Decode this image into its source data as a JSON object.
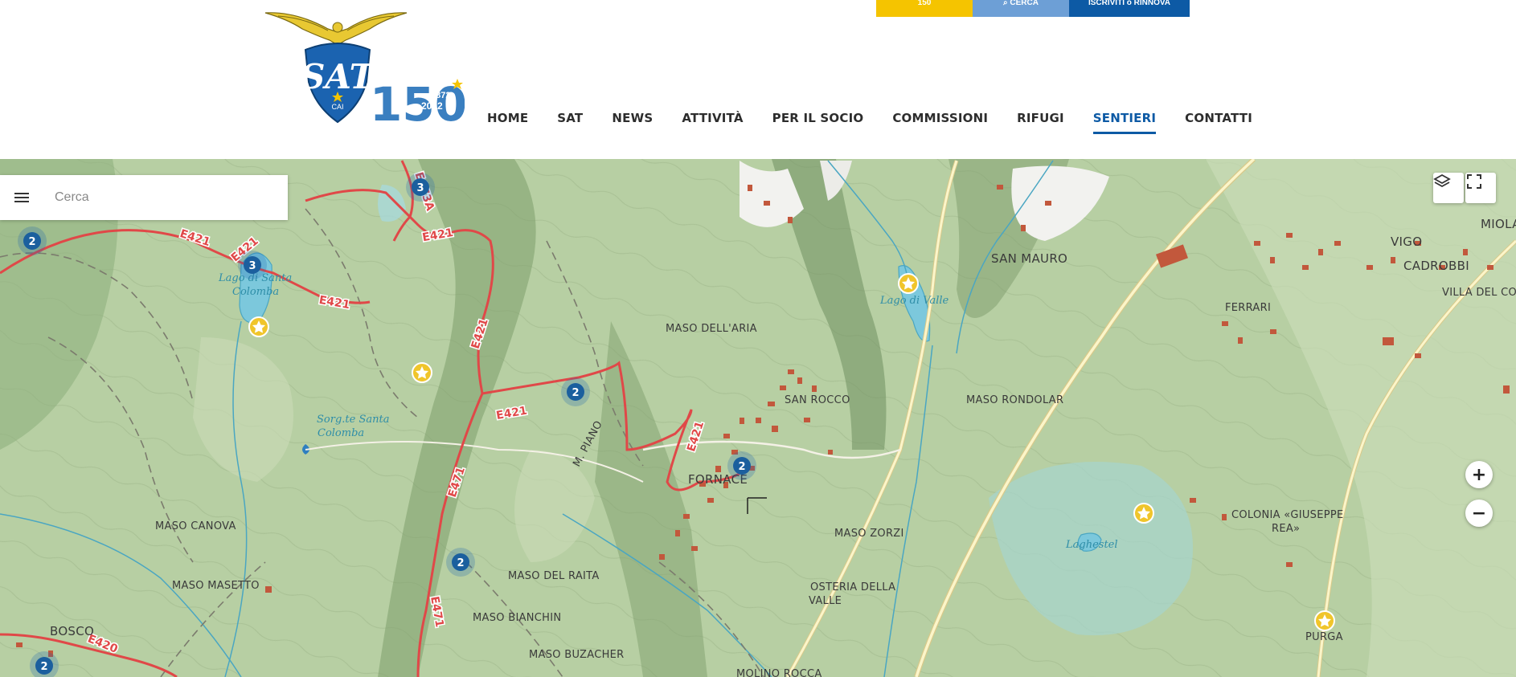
{
  "topbar": {
    "item_150": "150",
    "search": "CERCA",
    "join": "ISCRIVITI o RINNOVA"
  },
  "logo": {
    "sat_text": "SAT",
    "cai_text": "CAI",
    "anniversary": "150",
    "year_start": "1872",
    "year_end": "2022"
  },
  "nav": [
    {
      "label": "HOME"
    },
    {
      "label": "SAT"
    },
    {
      "label": "NEWS"
    },
    {
      "label": "ATTIVITÀ"
    },
    {
      "label": "PER IL SOCIO"
    },
    {
      "label": "COMMISSIONI"
    },
    {
      "label": "RIFUGI"
    },
    {
      "label": "SENTIERI",
      "active": true
    },
    {
      "label": "CONTATTI"
    }
  ],
  "search": {
    "placeholder": "Cerca",
    "menu_icon": "hamburger-menu-icon"
  },
  "map": {
    "places": {
      "san_mauro": "SAN MAURO",
      "vigo": "VIGO",
      "miola": "MIOLA",
      "cadrobbi": "CADROBBI",
      "villa": "VILLA DEL CO",
      "ferrari": "FERRARI",
      "maso_aria": "MASO DELL'ARIA",
      "san_rocco": "SAN ROCCO",
      "maso_rondolar": "MASO RONDOLAR",
      "fornace": "FORNACE",
      "maso_zorzi": "MASO ZORZI",
      "maso_canova": "MASO CANOVA",
      "maso_masetto": "MASO MASETTO",
      "maso_raita": "MASO DEL RAITA",
      "osteria_1": "OSTERIA DELLA",
      "osteria_2": "VALLE",
      "maso_bianchin": "MASO BIANCHIN",
      "maso_buzacher": "MASO BUZACHER",
      "bosco": "BOSCO",
      "molino": "MOLINO ROCCA",
      "colonia_1": "COLONIA «GIUSEPPE",
      "colonia_2": "REA»",
      "purga": "PURGA",
      "m_piano": "M. PIANO"
    },
    "water": {
      "lago_santa_1": "Lago di Santa",
      "lago_santa_2": "Colomba",
      "lago_valle": "Lago di Valle",
      "sorg_1": "Sorg.te Santa",
      "sorg_2": "Colomba",
      "laghestel": "Laghestel"
    },
    "trails": {
      "e421": "E421",
      "e471": "E471",
      "e473a": "E473A",
      "e420": "E420"
    },
    "clusters": {
      "c1": "2",
      "c2": "3",
      "c3": "3",
      "c4": "2",
      "c5": "2",
      "c6": "2",
      "c7": "2"
    },
    "controls": {
      "layers_icon": "layers-icon",
      "fullscreen_icon": "fullscreen-icon",
      "zoom_in": "+",
      "zoom_out": "−"
    }
  },
  "colors": {
    "brand_blue": "#0d5aa5",
    "yellow": "#f5c400",
    "light_blue": "#6d9fd6",
    "trail_red": "#e04848",
    "map_green": "#b9d1a6"
  }
}
